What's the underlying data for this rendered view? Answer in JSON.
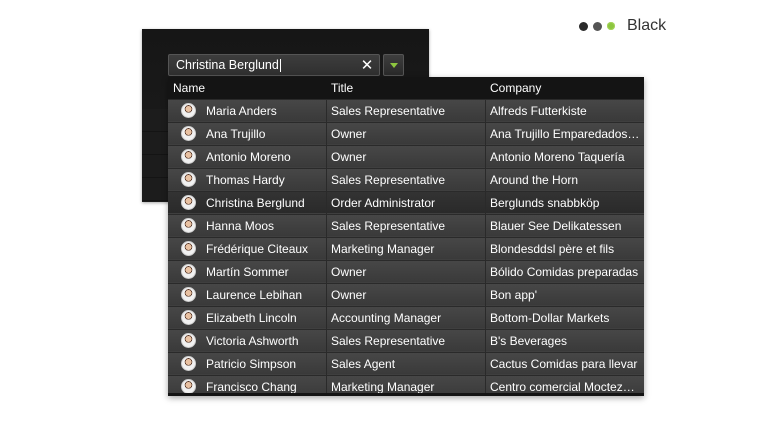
{
  "theme": {
    "label": "Black",
    "accent": "#8dc63f"
  },
  "combo": {
    "value": "Christina Berglund",
    "clear_icon": "close-icon",
    "dropdown_icon": "chevron-down-icon"
  },
  "grid": {
    "headers": {
      "name": "Name",
      "title": "Title",
      "company": "Company"
    },
    "rows": [
      {
        "name": "Maria Anders",
        "title": "Sales Representative",
        "company": "Alfreds Futterkiste"
      },
      {
        "name": "Ana Trujillo",
        "title": "Owner",
        "company": "Ana Trujillo Emparedados y..."
      },
      {
        "name": "Antonio Moreno",
        "title": "Owner",
        "company": "Antonio Moreno Taquería"
      },
      {
        "name": "Thomas Hardy",
        "title": "Sales Representative",
        "company": "Around the Horn"
      },
      {
        "name": "Christina Berglund",
        "title": "Order Administrator",
        "company": "Berglunds snabbköp"
      },
      {
        "name": "Hanna Moos",
        "title": "Sales Representative",
        "company": "Blauer See Delikatessen"
      },
      {
        "name": "Frédérique Citeaux",
        "title": "Marketing Manager",
        "company": "Blondesddsl père et fils"
      },
      {
        "name": "Martín Sommer",
        "title": "Owner",
        "company": "Bólido Comidas preparadas"
      },
      {
        "name": "Laurence Lebihan",
        "title": "Owner",
        "company": "Bon app'"
      },
      {
        "name": "Elizabeth Lincoln",
        "title": "Accounting Manager",
        "company": "Bottom-Dollar Markets"
      },
      {
        "name": "Victoria Ashworth",
        "title": "Sales Representative",
        "company": "B's Beverages"
      },
      {
        "name": "Patricio Simpson",
        "title": "Sales Agent",
        "company": "Cactus Comidas para llevar"
      },
      {
        "name": "Francisco Chang",
        "title": "Marketing Manager",
        "company": "Centro comercial Moctezuma"
      }
    ],
    "selected_row": "Christina Berglund"
  }
}
